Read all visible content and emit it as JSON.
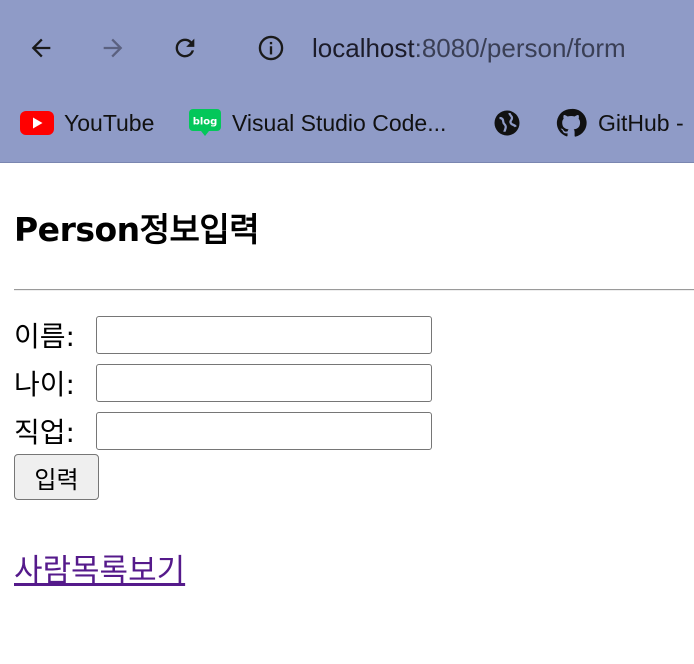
{
  "browser": {
    "url_host": "localhost",
    "url_path": ":8080/person/form",
    "bookmarks": [
      {
        "label": "YouTube",
        "icon": "youtube-icon"
      },
      {
        "label": "Visual Studio Code...",
        "icon": "blog-icon",
        "badge": "blog"
      },
      {
        "label": "",
        "icon": "globe-icon"
      },
      {
        "label": "GitHub -",
        "icon": "github-icon"
      }
    ],
    "colors": {
      "toolbar": "#8f9bc7",
      "youtube_red": "#ff0000",
      "blog_green": "#03c75a"
    }
  },
  "page": {
    "title": "Person정보입력",
    "form": {
      "name_label": "이름:",
      "name_value": "",
      "age_label": "나이:",
      "age_value": "",
      "job_label": "직업:",
      "job_value": "",
      "submit_label": "입력"
    },
    "list_link": "사람목록보기",
    "colors": {
      "visited_link": "#551a8b"
    }
  }
}
